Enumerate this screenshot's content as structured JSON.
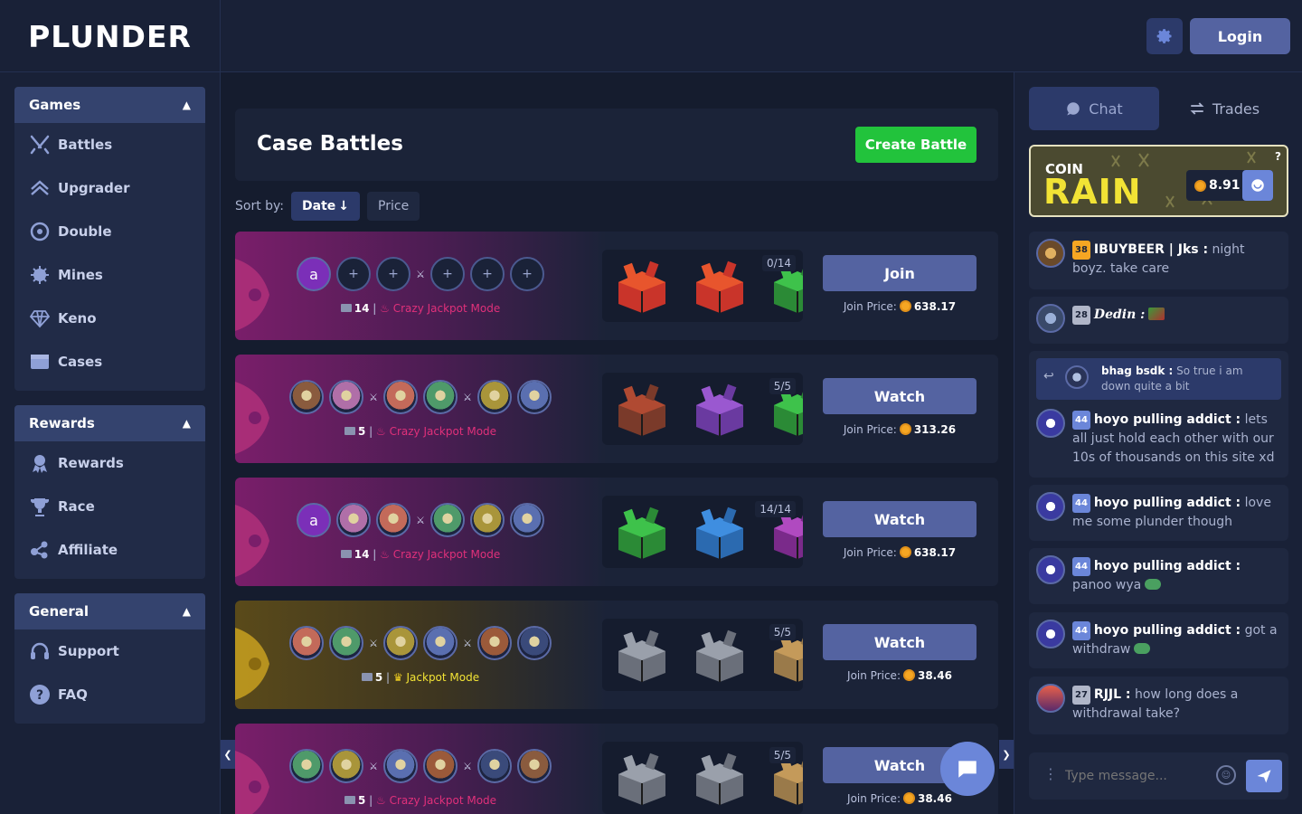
{
  "header": {
    "logo": "PLUNDER",
    "login_label": "Login"
  },
  "sidebar": {
    "games": {
      "title": "Games",
      "items": [
        {
          "label": "Battles",
          "icon": "crossed-swords-icon"
        },
        {
          "label": "Upgrader",
          "icon": "upgrade-arrows-icon"
        },
        {
          "label": "Double",
          "icon": "roulette-wheel-icon"
        },
        {
          "label": "Mines",
          "icon": "mine-icon"
        },
        {
          "label": "Keno",
          "icon": "diamond-icon"
        },
        {
          "label": "Cases",
          "icon": "case-icon"
        }
      ]
    },
    "rewards": {
      "title": "Rewards",
      "items": [
        {
          "label": "Rewards",
          "icon": "reward-badge-icon"
        },
        {
          "label": "Race",
          "icon": "trophy-icon"
        },
        {
          "label": "Affiliate",
          "icon": "affiliate-icon"
        }
      ]
    },
    "general": {
      "title": "General",
      "items": [
        {
          "label": "Support",
          "icon": "headset-icon"
        },
        {
          "label": "FAQ",
          "icon": "question-icon"
        }
      ]
    }
  },
  "main": {
    "title": "Case Battles",
    "create_label": "Create Battle",
    "sort_label": "Sort by:",
    "sort_date": "Date",
    "sort_price": "Price",
    "join_price_label": "Join Price:",
    "battles": [
      {
        "cases": "14",
        "mode": "Crazy Jackpot Mode",
        "count": "0/14",
        "action": "Join",
        "price": "638.17",
        "theme": "pink"
      },
      {
        "cases": "5",
        "mode": "Crazy Jackpot Mode",
        "count": "5/5",
        "action": "Watch",
        "price": "313.26",
        "theme": "pink"
      },
      {
        "cases": "14",
        "mode": "Crazy Jackpot Mode",
        "count": "14/14",
        "action": "Watch",
        "price": "638.17",
        "theme": "pink"
      },
      {
        "cases": "5",
        "mode": "Jackpot Mode",
        "count": "5/5",
        "action": "Watch",
        "price": "38.46",
        "theme": "gold"
      },
      {
        "cases": "5",
        "mode": "Crazy Jackpot Mode",
        "count": "5/5",
        "action": "Watch",
        "price": "38.46",
        "theme": "pink"
      }
    ]
  },
  "chat": {
    "tab_chat": "Chat",
    "tab_trades": "Trades",
    "rain": {
      "coin_label": "COIN",
      "rain_label": "RAIN",
      "amount": "8.91",
      "help": "?"
    },
    "messages": [
      {
        "level": "38",
        "user": "IBUYBEER | Jks :",
        "text": " night boyz. take care"
      },
      {
        "level": "28",
        "user": "Dedin :",
        "text": ""
      },
      {
        "reply_user": "bhag bsdk :",
        "reply_text": " So true i am down quite a bit",
        "level": "44",
        "user": "hoyo pulling addict :",
        "text": " lets all just hold each other with our 10s of thousands on this site xd"
      },
      {
        "level": "44",
        "user": "hoyo pulling addict :",
        "text": " love me some plunder though"
      },
      {
        "level": "44",
        "user": "hoyo pulling addict :",
        "text": " panoo wya"
      },
      {
        "level": "44",
        "user": "hoyo pulling addict :",
        "text": " got a withdraw"
      },
      {
        "level": "27",
        "user": "RJJL :",
        "text": " how long does a withdrawal take?"
      }
    ],
    "input_placeholder": "Type message..."
  }
}
